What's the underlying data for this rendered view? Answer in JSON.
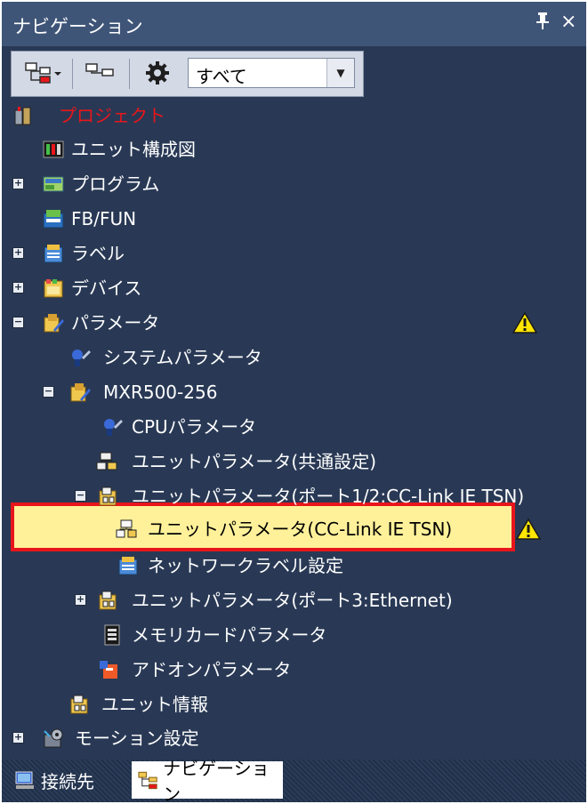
{
  "window": {
    "title": "ナビゲーション",
    "pin_label": "ᵽ",
    "close_label": "×"
  },
  "toolbar": {
    "filter_value": "すべて"
  },
  "tree": {
    "project": "プロジェクト",
    "unit_config": "ユニット構成図",
    "program": "プログラム",
    "fb_fun": "FB/FUN",
    "label": "ラベル",
    "device": "デバイス",
    "parameter": "パラメータ",
    "system_parameter": "システムパラメータ",
    "module": "MXR500-256",
    "cpu_parameter": "CPUパラメータ",
    "unit_param_common": "ユニットパラメータ(共通設定)",
    "unit_param_port12": "ユニットパラメータ(ポート1/2:CC-Link IE TSN)",
    "unit_param_cclink": "ユニットパラメータ(CC-Link IE TSN)",
    "network_label": "ネットワークラベル設定",
    "unit_param_port3": "ユニットパラメータ(ポート3:Ethernet)",
    "memory_card": "メモリカードパラメータ",
    "addon": "アドオンパラメータ",
    "unit_info": "ユニット情報",
    "motion": "モーション設定"
  },
  "tabs": {
    "connection": "接続先",
    "navigation": "ナビゲーション"
  },
  "colors": {
    "panel_bg": "#293955",
    "title_bg": "#3f5578",
    "project_text": "#e8161b",
    "selected_bg": "#fff19a",
    "selected_border": "#e8161b",
    "warning": "#ffe600"
  }
}
